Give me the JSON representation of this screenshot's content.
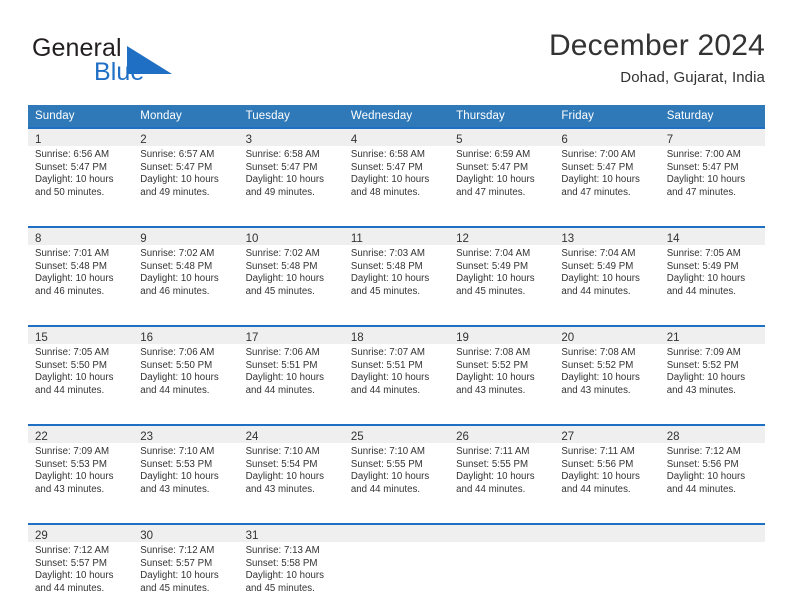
{
  "brand": {
    "name_line1": "General",
    "name_line2": "Blue",
    "triangle_color": "#1f6fc4",
    "text_color": "#231f20"
  },
  "header": {
    "title": "December 2024",
    "location": "Dohad, Gujarat, India"
  },
  "theme": {
    "header_bar": "#3079b8",
    "day_band": "#efefef",
    "day_band_border": "#1f6fc4",
    "text": "#333333"
  },
  "weekday_headers": [
    "Sunday",
    "Monday",
    "Tuesday",
    "Wednesday",
    "Thursday",
    "Friday",
    "Saturday"
  ],
  "labels": {
    "sunrise_prefix": "Sunrise:",
    "sunset_prefix": "Sunset:",
    "daylight_prefix": "Daylight:"
  },
  "weeks": [
    [
      {
        "day": "1",
        "sunrise": "Sunrise: 6:56 AM",
        "sunset": "Sunset: 5:47 PM",
        "daylight1": "Daylight: 10 hours",
        "daylight2": "and 50 minutes."
      },
      {
        "day": "2",
        "sunrise": "Sunrise: 6:57 AM",
        "sunset": "Sunset: 5:47 PM",
        "daylight1": "Daylight: 10 hours",
        "daylight2": "and 49 minutes."
      },
      {
        "day": "3",
        "sunrise": "Sunrise: 6:58 AM",
        "sunset": "Sunset: 5:47 PM",
        "daylight1": "Daylight: 10 hours",
        "daylight2": "and 49 minutes."
      },
      {
        "day": "4",
        "sunrise": "Sunrise: 6:58 AM",
        "sunset": "Sunset: 5:47 PM",
        "daylight1": "Daylight: 10 hours",
        "daylight2": "and 48 minutes."
      },
      {
        "day": "5",
        "sunrise": "Sunrise: 6:59 AM",
        "sunset": "Sunset: 5:47 PM",
        "daylight1": "Daylight: 10 hours",
        "daylight2": "and 47 minutes."
      },
      {
        "day": "6",
        "sunrise": "Sunrise: 7:00 AM",
        "sunset": "Sunset: 5:47 PM",
        "daylight1": "Daylight: 10 hours",
        "daylight2": "and 47 minutes."
      },
      {
        "day": "7",
        "sunrise": "Sunrise: 7:00 AM",
        "sunset": "Sunset: 5:47 PM",
        "daylight1": "Daylight: 10 hours",
        "daylight2": "and 47 minutes."
      }
    ],
    [
      {
        "day": "8",
        "sunrise": "Sunrise: 7:01 AM",
        "sunset": "Sunset: 5:48 PM",
        "daylight1": "Daylight: 10 hours",
        "daylight2": "and 46 minutes."
      },
      {
        "day": "9",
        "sunrise": "Sunrise: 7:02 AM",
        "sunset": "Sunset: 5:48 PM",
        "daylight1": "Daylight: 10 hours",
        "daylight2": "and 46 minutes."
      },
      {
        "day": "10",
        "sunrise": "Sunrise: 7:02 AM",
        "sunset": "Sunset: 5:48 PM",
        "daylight1": "Daylight: 10 hours",
        "daylight2": "and 45 minutes."
      },
      {
        "day": "11",
        "sunrise": "Sunrise: 7:03 AM",
        "sunset": "Sunset: 5:48 PM",
        "daylight1": "Daylight: 10 hours",
        "daylight2": "and 45 minutes."
      },
      {
        "day": "12",
        "sunrise": "Sunrise: 7:04 AM",
        "sunset": "Sunset: 5:49 PM",
        "daylight1": "Daylight: 10 hours",
        "daylight2": "and 45 minutes."
      },
      {
        "day": "13",
        "sunrise": "Sunrise: 7:04 AM",
        "sunset": "Sunset: 5:49 PM",
        "daylight1": "Daylight: 10 hours",
        "daylight2": "and 44 minutes."
      },
      {
        "day": "14",
        "sunrise": "Sunrise: 7:05 AM",
        "sunset": "Sunset: 5:49 PM",
        "daylight1": "Daylight: 10 hours",
        "daylight2": "and 44 minutes."
      }
    ],
    [
      {
        "day": "15",
        "sunrise": "Sunrise: 7:05 AM",
        "sunset": "Sunset: 5:50 PM",
        "daylight1": "Daylight: 10 hours",
        "daylight2": "and 44 minutes."
      },
      {
        "day": "16",
        "sunrise": "Sunrise: 7:06 AM",
        "sunset": "Sunset: 5:50 PM",
        "daylight1": "Daylight: 10 hours",
        "daylight2": "and 44 minutes."
      },
      {
        "day": "17",
        "sunrise": "Sunrise: 7:06 AM",
        "sunset": "Sunset: 5:51 PM",
        "daylight1": "Daylight: 10 hours",
        "daylight2": "and 44 minutes."
      },
      {
        "day": "18",
        "sunrise": "Sunrise: 7:07 AM",
        "sunset": "Sunset: 5:51 PM",
        "daylight1": "Daylight: 10 hours",
        "daylight2": "and 44 minutes."
      },
      {
        "day": "19",
        "sunrise": "Sunrise: 7:08 AM",
        "sunset": "Sunset: 5:52 PM",
        "daylight1": "Daylight: 10 hours",
        "daylight2": "and 43 minutes."
      },
      {
        "day": "20",
        "sunrise": "Sunrise: 7:08 AM",
        "sunset": "Sunset: 5:52 PM",
        "daylight1": "Daylight: 10 hours",
        "daylight2": "and 43 minutes."
      },
      {
        "day": "21",
        "sunrise": "Sunrise: 7:09 AM",
        "sunset": "Sunset: 5:52 PM",
        "daylight1": "Daylight: 10 hours",
        "daylight2": "and 43 minutes."
      }
    ],
    [
      {
        "day": "22",
        "sunrise": "Sunrise: 7:09 AM",
        "sunset": "Sunset: 5:53 PM",
        "daylight1": "Daylight: 10 hours",
        "daylight2": "and 43 minutes."
      },
      {
        "day": "23",
        "sunrise": "Sunrise: 7:10 AM",
        "sunset": "Sunset: 5:53 PM",
        "daylight1": "Daylight: 10 hours",
        "daylight2": "and 43 minutes."
      },
      {
        "day": "24",
        "sunrise": "Sunrise: 7:10 AM",
        "sunset": "Sunset: 5:54 PM",
        "daylight1": "Daylight: 10 hours",
        "daylight2": "and 43 minutes."
      },
      {
        "day": "25",
        "sunrise": "Sunrise: 7:10 AM",
        "sunset": "Sunset: 5:55 PM",
        "daylight1": "Daylight: 10 hours",
        "daylight2": "and 44 minutes."
      },
      {
        "day": "26",
        "sunrise": "Sunrise: 7:11 AM",
        "sunset": "Sunset: 5:55 PM",
        "daylight1": "Daylight: 10 hours",
        "daylight2": "and 44 minutes."
      },
      {
        "day": "27",
        "sunrise": "Sunrise: 7:11 AM",
        "sunset": "Sunset: 5:56 PM",
        "daylight1": "Daylight: 10 hours",
        "daylight2": "and 44 minutes."
      },
      {
        "day": "28",
        "sunrise": "Sunrise: 7:12 AM",
        "sunset": "Sunset: 5:56 PM",
        "daylight1": "Daylight: 10 hours",
        "daylight2": "and 44 minutes."
      }
    ],
    [
      {
        "day": "29",
        "sunrise": "Sunrise: 7:12 AM",
        "sunset": "Sunset: 5:57 PM",
        "daylight1": "Daylight: 10 hours",
        "daylight2": "and 44 minutes."
      },
      {
        "day": "30",
        "sunrise": "Sunrise: 7:12 AM",
        "sunset": "Sunset: 5:57 PM",
        "daylight1": "Daylight: 10 hours",
        "daylight2": "and 45 minutes."
      },
      {
        "day": "31",
        "sunrise": "Sunrise: 7:13 AM",
        "sunset": "Sunset: 5:58 PM",
        "daylight1": "Daylight: 10 hours",
        "daylight2": "and 45 minutes."
      },
      {
        "day": "",
        "sunrise": "",
        "sunset": "",
        "daylight1": "",
        "daylight2": ""
      },
      {
        "day": "",
        "sunrise": "",
        "sunset": "",
        "daylight1": "",
        "daylight2": ""
      },
      {
        "day": "",
        "sunrise": "",
        "sunset": "",
        "daylight1": "",
        "daylight2": ""
      },
      {
        "day": "",
        "sunrise": "",
        "sunset": "",
        "daylight1": "",
        "daylight2": ""
      }
    ]
  ]
}
